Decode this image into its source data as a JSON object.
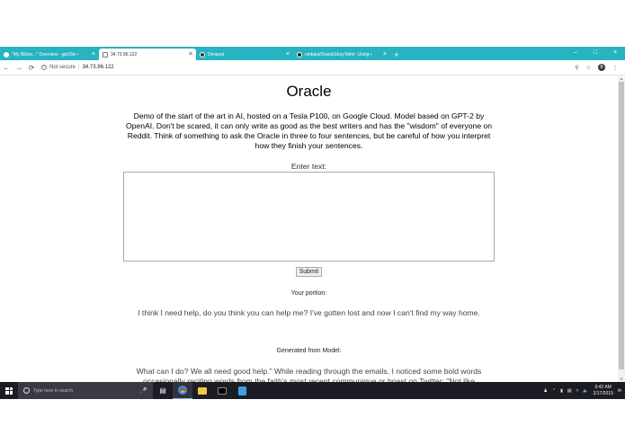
{
  "browser": {
    "tabs": [
      {
        "title": "\"My Billion...\" Overview - gpt1hb •",
        "active": false
      },
      {
        "title": "34.73.96.122",
        "active": true
      },
      {
        "title": "Devpost",
        "active": false
      },
      {
        "title": "nmkqui/OracleStoryTeller: Using •",
        "active": false
      }
    ],
    "new_tab": "+",
    "close_glyph": "×",
    "window_controls": {
      "minimize": "–",
      "maximize": "□",
      "close": "×"
    },
    "nav": {
      "back": "←",
      "forward": "→",
      "reload": "⟳"
    },
    "security_label": "Not secure",
    "url": "34.73.96.122",
    "profile_initial": "B"
  },
  "page": {
    "title": "Oracle",
    "description": "Demo of the start of the art in AI, hosted on a Tesla P100, on Google Cloud. Model based on GPT-2 by OpenAI. Don't be scared, it can only write as good as the best writers and has the \"wisdom\" of everyone on Reddit. Think of something to ask the Oracle in three to four sentences, but be careful of how you interpret how they finish your sentences.",
    "input_label": "Enter text:",
    "input_value": "",
    "submit_label": "Submit",
    "portion_heading": "Your portion:",
    "portion_text": "I think I need help, do you think you can help me? I've gotten lost and now I can't find my way home.",
    "generated_heading": "Generated from Model:",
    "generated_text": "What can I do? We all need good help.\"  While reading through the emails, I noticed some bold words occasionally reciting words from the faith's most recent communique or boast on Twitter: \"Not like"
  },
  "taskbar": {
    "search_placeholder": "Type here to search",
    "time": "9:42 AM",
    "date": "2/17/2019"
  },
  "colors": {
    "tabbar": "#27b3c2",
    "taskbar": "#1c1c24"
  }
}
